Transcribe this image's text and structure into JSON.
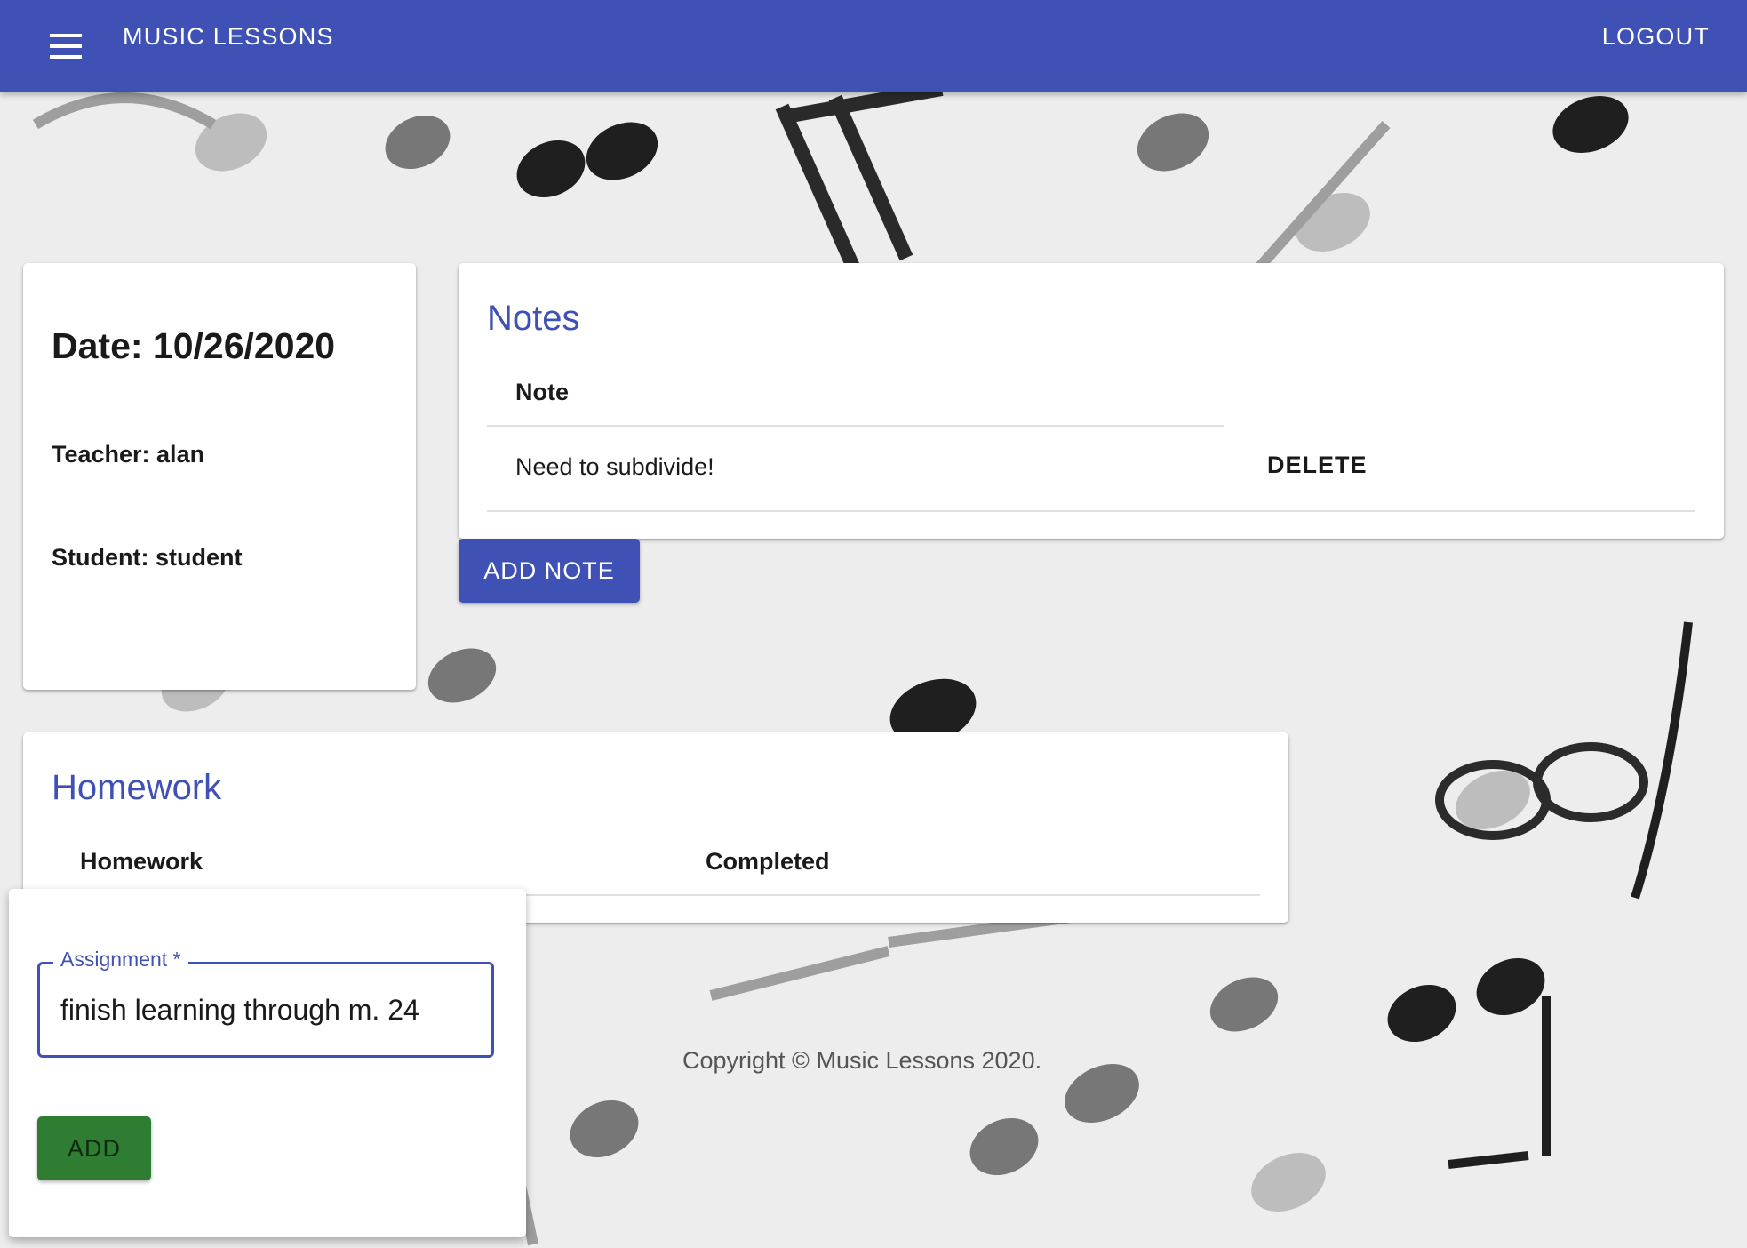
{
  "appbar": {
    "title": "MUSIC LESSONS",
    "logout_label": "LOGOUT"
  },
  "lesson_info": {
    "date": "Date: 10/26/2020",
    "teacher": "Teacher: alan",
    "student": "Student: student"
  },
  "notes": {
    "heading": "Notes",
    "column_header": "Note",
    "rows": [
      {
        "note": "Need to subdivide!",
        "delete_label": "DELETE"
      }
    ],
    "add_label": "ADD NOTE"
  },
  "homework": {
    "heading": "Homework",
    "columns": [
      "Homework",
      "Completed"
    ]
  },
  "assignment_form": {
    "label": "Assignment *",
    "value": "finish learning through m. 24",
    "add_label": "ADD"
  },
  "footer": {
    "copyright": "Copyright © Music Lessons 2020."
  },
  "colors": {
    "primary": "#3f51b5",
    "add_button": "#2e7d32"
  }
}
